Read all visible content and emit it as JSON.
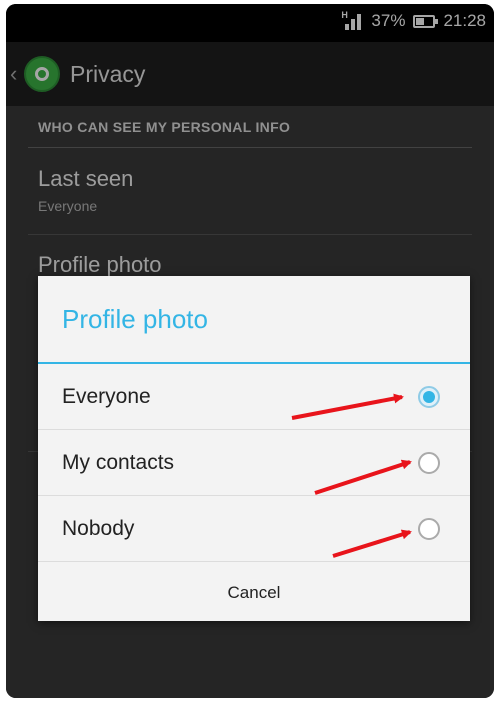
{
  "status": {
    "battery": "37%",
    "time": "21:28"
  },
  "header": {
    "title": "Privacy"
  },
  "section": {
    "title": "WHO CAN SEE MY PERSONAL INFO"
  },
  "prefs": [
    {
      "title": "Last seen",
      "summary": "Everyone"
    },
    {
      "title": "Profile photo"
    }
  ],
  "dialog": {
    "title": "Profile photo",
    "options": [
      {
        "label": "Everyone",
        "checked": true
      },
      {
        "label": "My contacts",
        "checked": false
      },
      {
        "label": "Nobody",
        "checked": false
      }
    ],
    "cancel_label": "Cancel"
  },
  "colors": {
    "accent": "#33b5e5",
    "annotation_arrow": "#e8141b",
    "app_green": "#3cb246"
  }
}
